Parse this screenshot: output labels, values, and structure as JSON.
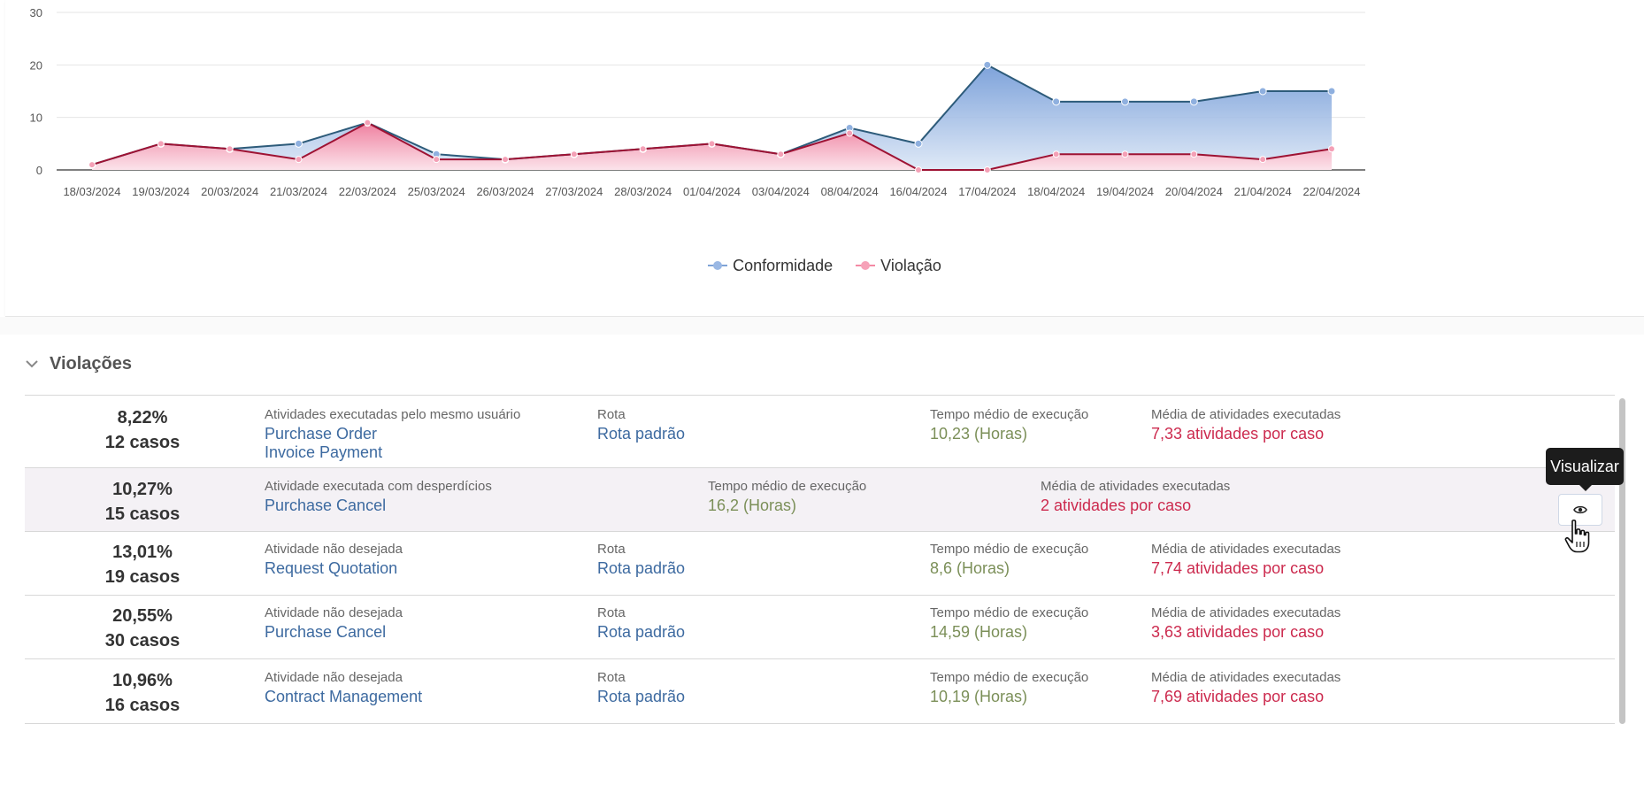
{
  "chart_data": {
    "type": "area",
    "categories": [
      "18/03/2024",
      "19/03/2024",
      "20/03/2024",
      "21/03/2024",
      "22/03/2024",
      "25/03/2024",
      "26/03/2024",
      "27/03/2024",
      "28/03/2024",
      "01/04/2024",
      "03/04/2024",
      "08/04/2024",
      "16/04/2024",
      "17/04/2024",
      "18/04/2024",
      "19/04/2024",
      "20/04/2024",
      "21/04/2024",
      "22/04/2024"
    ],
    "series": [
      {
        "name": "Conformidade",
        "color": "#2d5b7a",
        "values": [
          1,
          5,
          4,
          5,
          9,
          3,
          2,
          3,
          4,
          5,
          3,
          8,
          5,
          20,
          13,
          13,
          13,
          15,
          15
        ]
      },
      {
        "name": "Violação",
        "color": "#9e1233",
        "values": [
          1,
          5,
          4,
          2,
          9,
          2,
          2,
          3,
          4,
          5,
          3,
          7,
          0,
          0,
          3,
          3,
          3,
          2,
          4
        ]
      }
    ],
    "yticks": [
      0,
      10,
      20,
      30
    ],
    "ylim": [
      0,
      30
    ],
    "grid": true,
    "legend": "bottom-center"
  },
  "section": {
    "title": "Violações"
  },
  "violations": [
    {
      "percent": "8,22%",
      "cases": "12 casos",
      "type_label": "Atividades executadas pelo mesmo usuário",
      "activities": [
        "Purchase Order",
        "Invoice Payment"
      ],
      "route_label": "Rota",
      "route_value": "Rota padrão",
      "time_label": "Tempo médio de execução",
      "time_value": "10,23 (Horas)",
      "avg_label": "Média de atividades executadas",
      "avg_value": "7,33 atividades por caso"
    },
    {
      "percent": "10,27%",
      "cases": "15 casos",
      "type_label": "Atividade executada com desperdícios",
      "activities": [
        "Purchase Cancel"
      ],
      "time_label": "Tempo médio de execução",
      "time_value": "16,2 (Horas)",
      "avg_label": "Média de atividades executadas",
      "avg_value": "2 atividades por caso"
    },
    {
      "percent": "13,01%",
      "cases": "19 casos",
      "type_label": "Atividade não desejada",
      "activities": [
        "Request Quotation"
      ],
      "route_label": "Rota",
      "route_value": "Rota padrão",
      "time_label": "Tempo médio de execução",
      "time_value": "8,6 (Horas)",
      "avg_label": "Média de atividades executadas",
      "avg_value": "7,74 atividades por caso"
    },
    {
      "percent": "20,55%",
      "cases": "30 casos",
      "type_label": "Atividade não desejada",
      "activities": [
        "Purchase Cancel"
      ],
      "route_label": "Rota",
      "route_value": "Rota padrão",
      "time_label": "Tempo médio de execução",
      "time_value": "14,59 (Horas)",
      "avg_label": "Média de atividades executadas",
      "avg_value": "3,63 atividades por caso"
    },
    {
      "percent": "10,96%",
      "cases": "16 casos",
      "type_label": "Atividade não desejada",
      "activities": [
        "Contract Management"
      ],
      "route_label": "Rota",
      "route_value": "Rota padrão",
      "time_label": "Tempo médio de execução",
      "time_value": "10,19 (Horas)",
      "avg_label": "Média de atividades executadas",
      "avg_value": "7,69 atividades por caso"
    }
  ],
  "tooltip": {
    "text": "Visualizar"
  },
  "view_button": {
    "icon": "eye-icon"
  }
}
